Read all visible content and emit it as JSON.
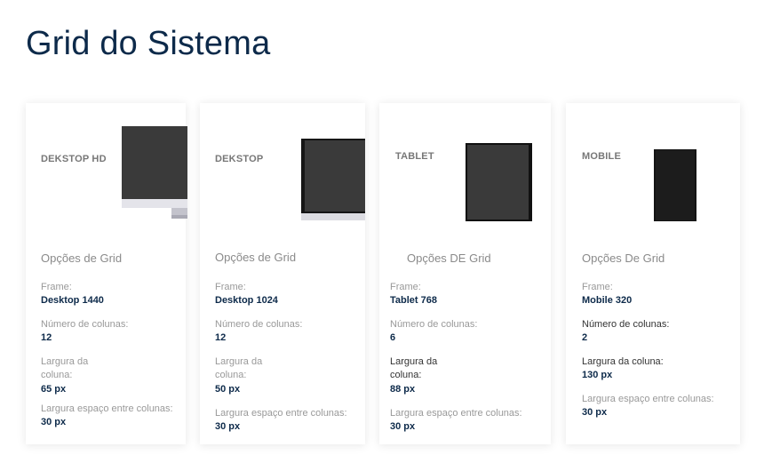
{
  "page": {
    "title": "Grid do Sistema"
  },
  "cards": [
    {
      "device_icon": "imac-icon",
      "title": "DEKSTOP HD",
      "section": "Opções de Grid",
      "frame_label": "Frame:",
      "frame_value": "Desktop 1440",
      "columns_label": "Número de colunas:",
      "columns_value": "12",
      "col_width_label_1": "Largura da",
      "col_width_label_2": "coluna:",
      "col_width_value": "65 px",
      "gutter_label": "Largura espaço entre colunas:",
      "gutter_value": "30 px"
    },
    {
      "device_icon": "laptop-icon",
      "title": "DEKSTOP",
      "section": "Opções de Grid",
      "frame_label": "Frame:",
      "frame_value": "Desktop 1024",
      "columns_label": "Número de colunas:",
      "columns_value": "12",
      "col_width_label_1": "Largura da",
      "col_width_label_2": "coluna:",
      "col_width_value": "50 px",
      "gutter_label": "Largura espaço entre colunas:",
      "gutter_value": "30 px"
    },
    {
      "device_icon": "tablet-icon",
      "title": "TABLET",
      "section": "Opções DE Grid",
      "frame_label": "Frame:",
      "frame_value": "Tablet 768",
      "columns_label": "Número de colunas:",
      "columns_value": "6",
      "col_width_label_1": "Largura da",
      "col_width_label_2": "coluna:",
      "col_width_value": "88 px",
      "gutter_label": "Largura espaço entre colunas:",
      "gutter_value": "30 px"
    },
    {
      "device_icon": "phone-icon",
      "title": "MOBILE",
      "section": "Opções De Grid",
      "frame_label": "Frame:",
      "frame_value": "Mobile 320",
      "columns_label": "Número de colunas:",
      "columns_value": "2",
      "col_width_label": "Largura da coluna:",
      "col_width_value": "130 px",
      "gutter_label": "Largura espaço entre colunas:",
      "gutter_value": "30 px"
    }
  ]
}
